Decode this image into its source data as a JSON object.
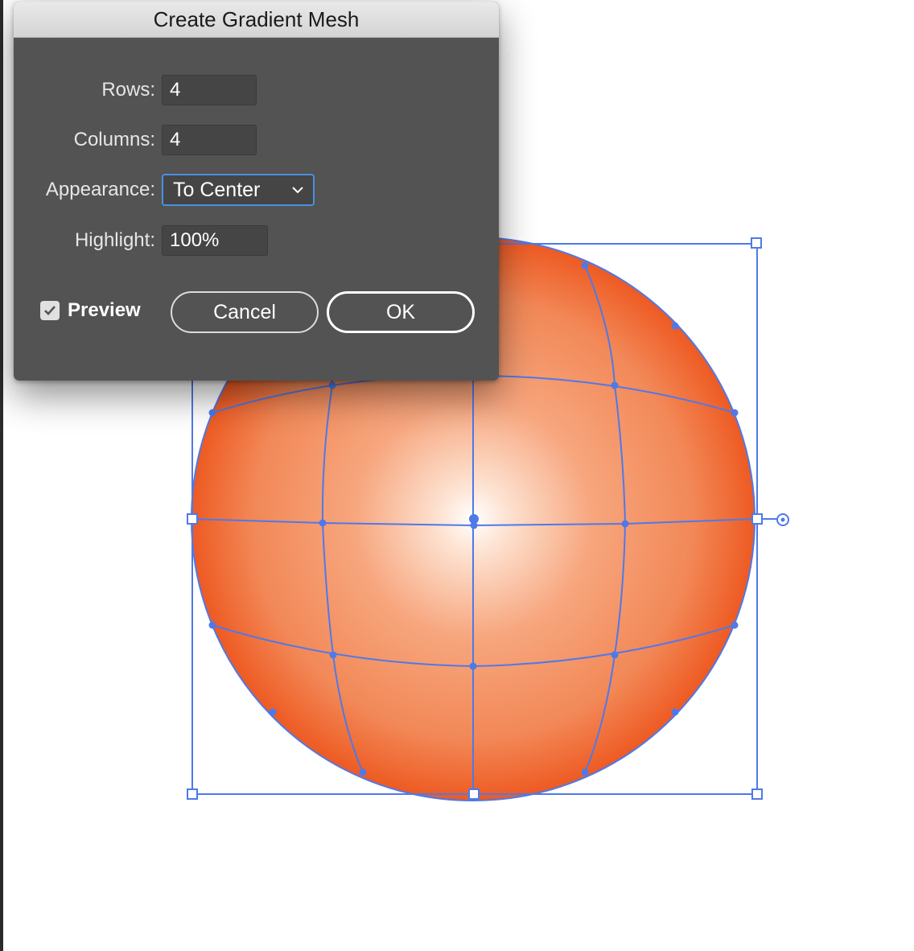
{
  "dialog": {
    "title": "Create Gradient Mesh",
    "rows_label": "Rows:",
    "rows_value": "4",
    "columns_label": "Columns:",
    "columns_value": "4",
    "appearance_label": "Appearance:",
    "appearance_value": "To Center",
    "highlight_label": "Highlight:",
    "highlight_value": "100%",
    "preview_label": "Preview",
    "preview_checked": true,
    "cancel_label": "Cancel",
    "ok_label": "OK"
  },
  "icons": {
    "dropdown": "chevron-down-icon",
    "checkbox": "checkmark-icon",
    "rotate_handle": "rotate-handle-icon"
  },
  "colors": {
    "dialog_bg": "#535353",
    "accent": "#4a90e2",
    "selection": "#4f79e8",
    "mesh_edge": "#ef5a22",
    "mesh_highlight": "#ffffff"
  }
}
